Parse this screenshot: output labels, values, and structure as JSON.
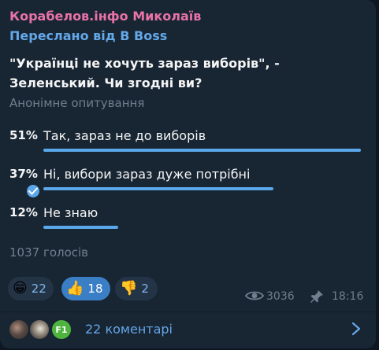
{
  "message": {
    "channel_name": "Корабелов.інфо Миколаїв",
    "forwarded_from": "Переслано від B Boss"
  },
  "poll": {
    "question": "\"Українці не хочуть зараз виборів\", - Зеленський. Чи згодні ви?",
    "type_label": "Анонімне опитування",
    "options": [
      {
        "percent": "51%",
        "text": "Так, зараз не до виборів",
        "share": 0.51,
        "chosen": false
      },
      {
        "percent": "37%",
        "text": "Ні, вибори зараз дуже потрібні",
        "share": 0.37,
        "chosen": true
      },
      {
        "percent": "12%",
        "text": "Не знаю",
        "share": 0.12,
        "chosen": false
      }
    ],
    "total_votes": "1037 голосів"
  },
  "reactions": [
    {
      "emoji": "😁",
      "icon": "grinning-face-icon",
      "count": "22",
      "active": false
    },
    {
      "emoji": "👍",
      "icon": "thumbs-up-icon",
      "count": "18",
      "active": true
    },
    {
      "emoji": "👎",
      "icon": "thumbs-down-icon",
      "count": "2",
      "active": false
    }
  ],
  "meta": {
    "views": "3036",
    "time": "18:16"
  },
  "comments": {
    "label": "22 коментарі",
    "avatars": [
      {
        "icon": "avatar-photo-icon",
        "initials": ""
      },
      {
        "icon": "avatar-photo-icon",
        "initials": ""
      },
      {
        "icon": "avatar-initials-icon",
        "initials": "F1"
      }
    ]
  },
  "colors": {
    "background": "#0e1621",
    "bubble": "#182533",
    "channel_name": "#e873a8",
    "accent": "#64a8e8",
    "bar": "#5aa7ea",
    "muted": "#6f7f8f",
    "text": "#f5f5f5"
  }
}
